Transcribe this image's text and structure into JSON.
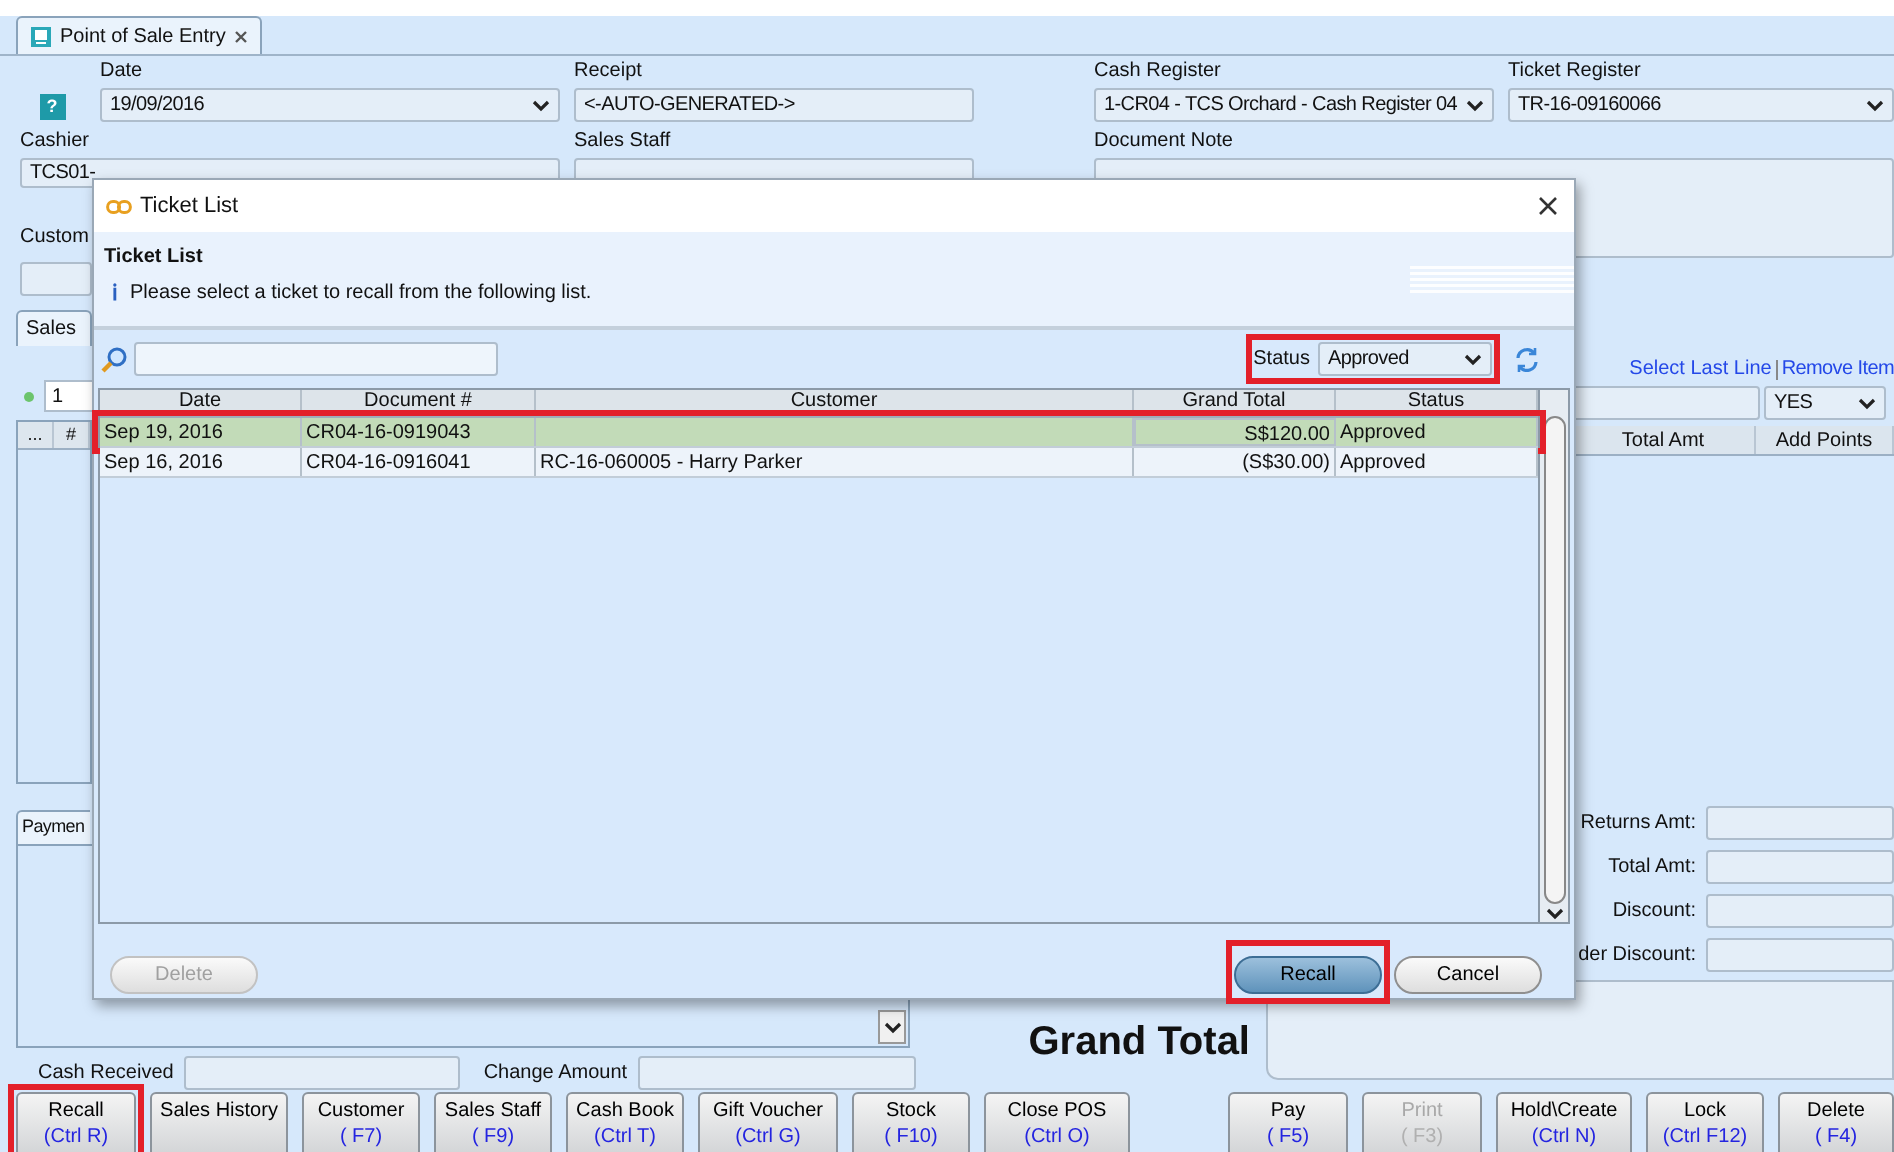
{
  "tab": {
    "label": "Point of Sale Entry",
    "selected": true
  },
  "top_fields": [
    {
      "label": "Date",
      "value": "19/09/2016",
      "kind": "select"
    },
    {
      "label": "Receipt",
      "value": "<-AUTO-GENERATED->",
      "kind": "text"
    },
    {
      "label": "Cash Register",
      "value": "1-CR04 - TCS Orchard - Cash Register 04",
      "kind": "select"
    },
    {
      "label": "Ticket Register",
      "value": "TR-16-09160066",
      "kind": "select"
    }
  ],
  "help_button": "?",
  "cashier": {
    "label": "Cashier",
    "value": "TCS01-"
  },
  "sales_staff": {
    "label": "Sales Staff"
  },
  "document_note": {
    "label": "Document Note"
  },
  "customer": {
    "label": "Custom"
  },
  "sales_tab": {
    "label": "Sales",
    "selected": true
  },
  "line_field": "1",
  "left_grid_columns": [
    "...",
    "#"
  ],
  "links": [
    "Select Last Line",
    "Remove Item"
  ],
  "add_points_select": "YES",
  "item_columns": [
    "Total Amt",
    "Add Points"
  ],
  "payment_tab": {
    "label": "Paymen",
    "selected": true
  },
  "totals": [
    {
      "label": "Returns Amt:"
    },
    {
      "label": "Total Amt:"
    },
    {
      "label": "Discount:"
    },
    {
      "label": "der Discount:"
    }
  ],
  "grand_total": {
    "label": "Grand Total"
  },
  "cash_received": {
    "label": "Cash Received"
  },
  "change_amount": {
    "label": "Change Amount"
  },
  "buttons_left": [
    {
      "label": "Recall",
      "shortcut": "(Ctrl R)",
      "disabled": false,
      "highlighted": true
    },
    {
      "label": "Sales History",
      "disabled": false,
      "highlighted": false
    },
    {
      "label": "Customer",
      "shortcut": "( F7)",
      "disabled": false,
      "highlighted": false
    },
    {
      "label": "Sales Staff",
      "shortcut": "( F9)",
      "disabled": false,
      "highlighted": false
    },
    {
      "label": "Cash Book",
      "shortcut": "(Ctrl T)",
      "disabled": false,
      "highlighted": false
    },
    {
      "label": "Gift Voucher",
      "shortcut": "(Ctrl G)",
      "disabled": false,
      "highlighted": false
    },
    {
      "label": "Stock",
      "shortcut": "( F10)",
      "disabled": false,
      "highlighted": false
    },
    {
      "label": "Close POS",
      "shortcut": "(Ctrl O)",
      "disabled": false,
      "highlighted": false
    }
  ],
  "buttons_right": [
    {
      "label": "Pay",
      "shortcut": "( F5)",
      "disabled": false,
      "highlighted": false
    },
    {
      "label": "Print",
      "shortcut": "( F3)",
      "disabled": true,
      "highlighted": false
    },
    {
      "label": "Hold\\Create",
      "shortcut": "(Ctrl N)",
      "disabled": false,
      "highlighted": false
    },
    {
      "label": "Lock",
      "shortcut": "(Ctrl F12)",
      "disabled": false,
      "highlighted": false
    },
    {
      "label": "Delete",
      "shortcut": "( F4)",
      "disabled": false,
      "highlighted": false
    }
  ],
  "dialog": {
    "title": "Ticket List",
    "heading": "Ticket List",
    "info_icon": "ℹ",
    "message": "Please select a ticket to recall from the following list.",
    "status_filter": {
      "label": "Status",
      "value": "Approved",
      "highlighted": true
    },
    "columns": [
      "Date",
      "Document #",
      "Customer",
      "Grand Total",
      "Status"
    ],
    "rows": [
      {
        "date": "Sep 19, 2016",
        "document": "CR04-16-0919043",
        "grand_total": "S$120.00",
        "status": "Approved",
        "selected": true,
        "highlighted": true
      },
      {
        "date": "Sep 16, 2016",
        "document": "CR04-16-0916041",
        "customer": "RC-16-060005 - Harry Parker",
        "grand_total": "(S$30.00)",
        "status": "Approved",
        "selected": false,
        "highlighted": false
      }
    ],
    "buttons": [
      {
        "label": "Delete",
        "kind": "plain",
        "disabled": true,
        "highlighted": false
      },
      {
        "label": "Recall",
        "kind": "default",
        "disabled": false,
        "highlighted": true
      },
      {
        "label": "Cancel",
        "kind": "plain",
        "disabled": false,
        "highlighted": false
      }
    ]
  }
}
